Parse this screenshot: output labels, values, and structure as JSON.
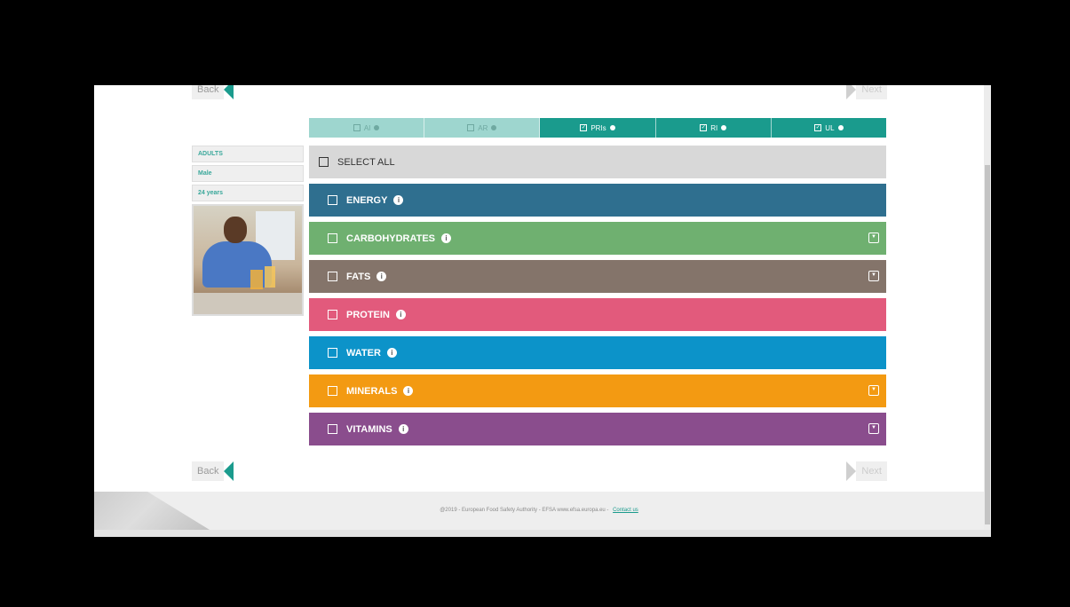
{
  "nav": {
    "back_label": "Back",
    "next_label": "Next"
  },
  "tabs": [
    {
      "label": "AI",
      "active": false
    },
    {
      "label": "AR",
      "active": false
    },
    {
      "label": "PRIs",
      "active": true
    },
    {
      "label": "RI",
      "active": true
    },
    {
      "label": "UL",
      "active": true
    }
  ],
  "profile": {
    "group": "ADULTS",
    "sex": "Male",
    "age": "24 years"
  },
  "select_all": "SELECT ALL",
  "groups": [
    {
      "label": "ENERGY",
      "color": "#2f6f8f",
      "expandable": false
    },
    {
      "label": "CARBOHYDRATES",
      "color": "#6fb070",
      "expandable": true
    },
    {
      "label": "FATS",
      "color": "#84746a",
      "expandable": true
    },
    {
      "label": "PROTEIN",
      "color": "#e25a7c",
      "expandable": false
    },
    {
      "label": "WATER",
      "color": "#0c93c9",
      "expandable": false
    },
    {
      "label": "MINERALS",
      "color": "#f39a12",
      "expandable": true
    },
    {
      "label": "VITAMINS",
      "color": "#8a4d8d",
      "expandable": true
    }
  ],
  "footer": {
    "text": "@2019 - European Food Safety Authority - EFSA www.efsa.europa.eu -",
    "contact": "Contact us"
  }
}
